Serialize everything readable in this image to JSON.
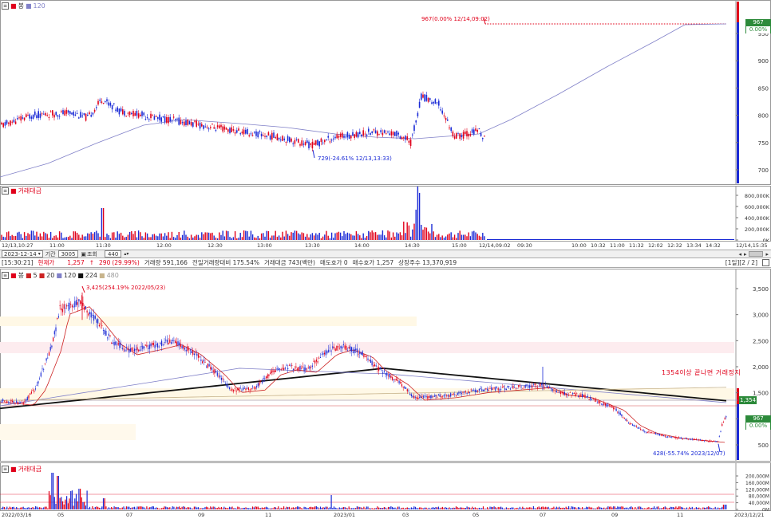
{
  "top_chart": {
    "legend": {
      "price_label": "봉",
      "ma_label": "120"
    },
    "annotation_high": "967(0.00% 12/14,09:02)",
    "annotation_low": "729(-24.61% 12/13,13:33)",
    "right_axis_ticks": [
      "950",
      "900",
      "850",
      "800",
      "750",
      "700"
    ],
    "price_box": {
      "price": "967",
      "change": "0.00%"
    },
    "volume_legend": "거래대금",
    "volume_ticks": [
      "800,000K",
      "600,000K",
      "400,000K",
      "200,000K",
      "0K"
    ],
    "time_labels": [
      "12/13,10:27",
      "11:00",
      "11:30",
      "12:00",
      "12:30",
      "13:00",
      "13:30",
      "14:00",
      "14:30",
      "15:00",
      "12/14,09:02",
      "09:30",
      "10:00",
      "10:32",
      "11:00",
      "11:32",
      "12:02",
      "12:32",
      "13:34",
      "14:32",
      "12/14,15:35"
    ]
  },
  "toolbar": {
    "date": "2023-12-14",
    "period_label": "기간",
    "count": "3005",
    "query_label": "조회",
    "zoom": "440"
  },
  "status_bar": {
    "time": "[15:30:21]",
    "current_label": "현재가",
    "current_value": "1,257",
    "arrow": "↑",
    "change": "290",
    "change_pct": "(29.99%)",
    "volume": "거래량 591,166",
    "prev_ratio": "전일거래량대비 175.54%",
    "trade_amount": "거래대금 743(백만)",
    "ask_remain": "매도호가 0",
    "bid": "매수호가 1,257",
    "shares": "상장주수 13,370,919",
    "right_info": "[1일][2 / 2]"
  },
  "bottom_chart": {
    "legend": {
      "price_label": "봉",
      "ma5": "5",
      "ma20": "20",
      "ma120": "120",
      "ma224": "224",
      "ma480": "480"
    },
    "annotation_high": "3,425(254.19% 2022/05/23)",
    "annotation_low": "428(-55.74% 2023/12/07)",
    "note": "1354이상 끝나면 거래정지",
    "price_tag": "1,354",
    "price_box": {
      "price": "967",
      "change": "0.00%"
    },
    "right_axis_ticks": [
      "3,500",
      "3,000",
      "2,500",
      "2,000",
      "1,500",
      "1,000",
      "500"
    ],
    "volume_legend": "거래대금",
    "volume_ticks": [
      "200,000M",
      "160,000M",
      "120,000M",
      "80,000M",
      "40,000M",
      "0M"
    ],
    "date_labels": [
      "2022/03/16",
      "05",
      "07",
      "09",
      "11",
      "2023/01",
      "03",
      "05",
      "07",
      "09",
      "11",
      "2023/12/21"
    ]
  },
  "colors": {
    "up": "#e0001a",
    "down": "#1a2ad6",
    "ma_blue": "#8080c8",
    "ma_red": "#cc2222",
    "ma_black": "#111111",
    "ma_tan": "#c8b48c",
    "accent_green": "#2c8a3a"
  }
}
